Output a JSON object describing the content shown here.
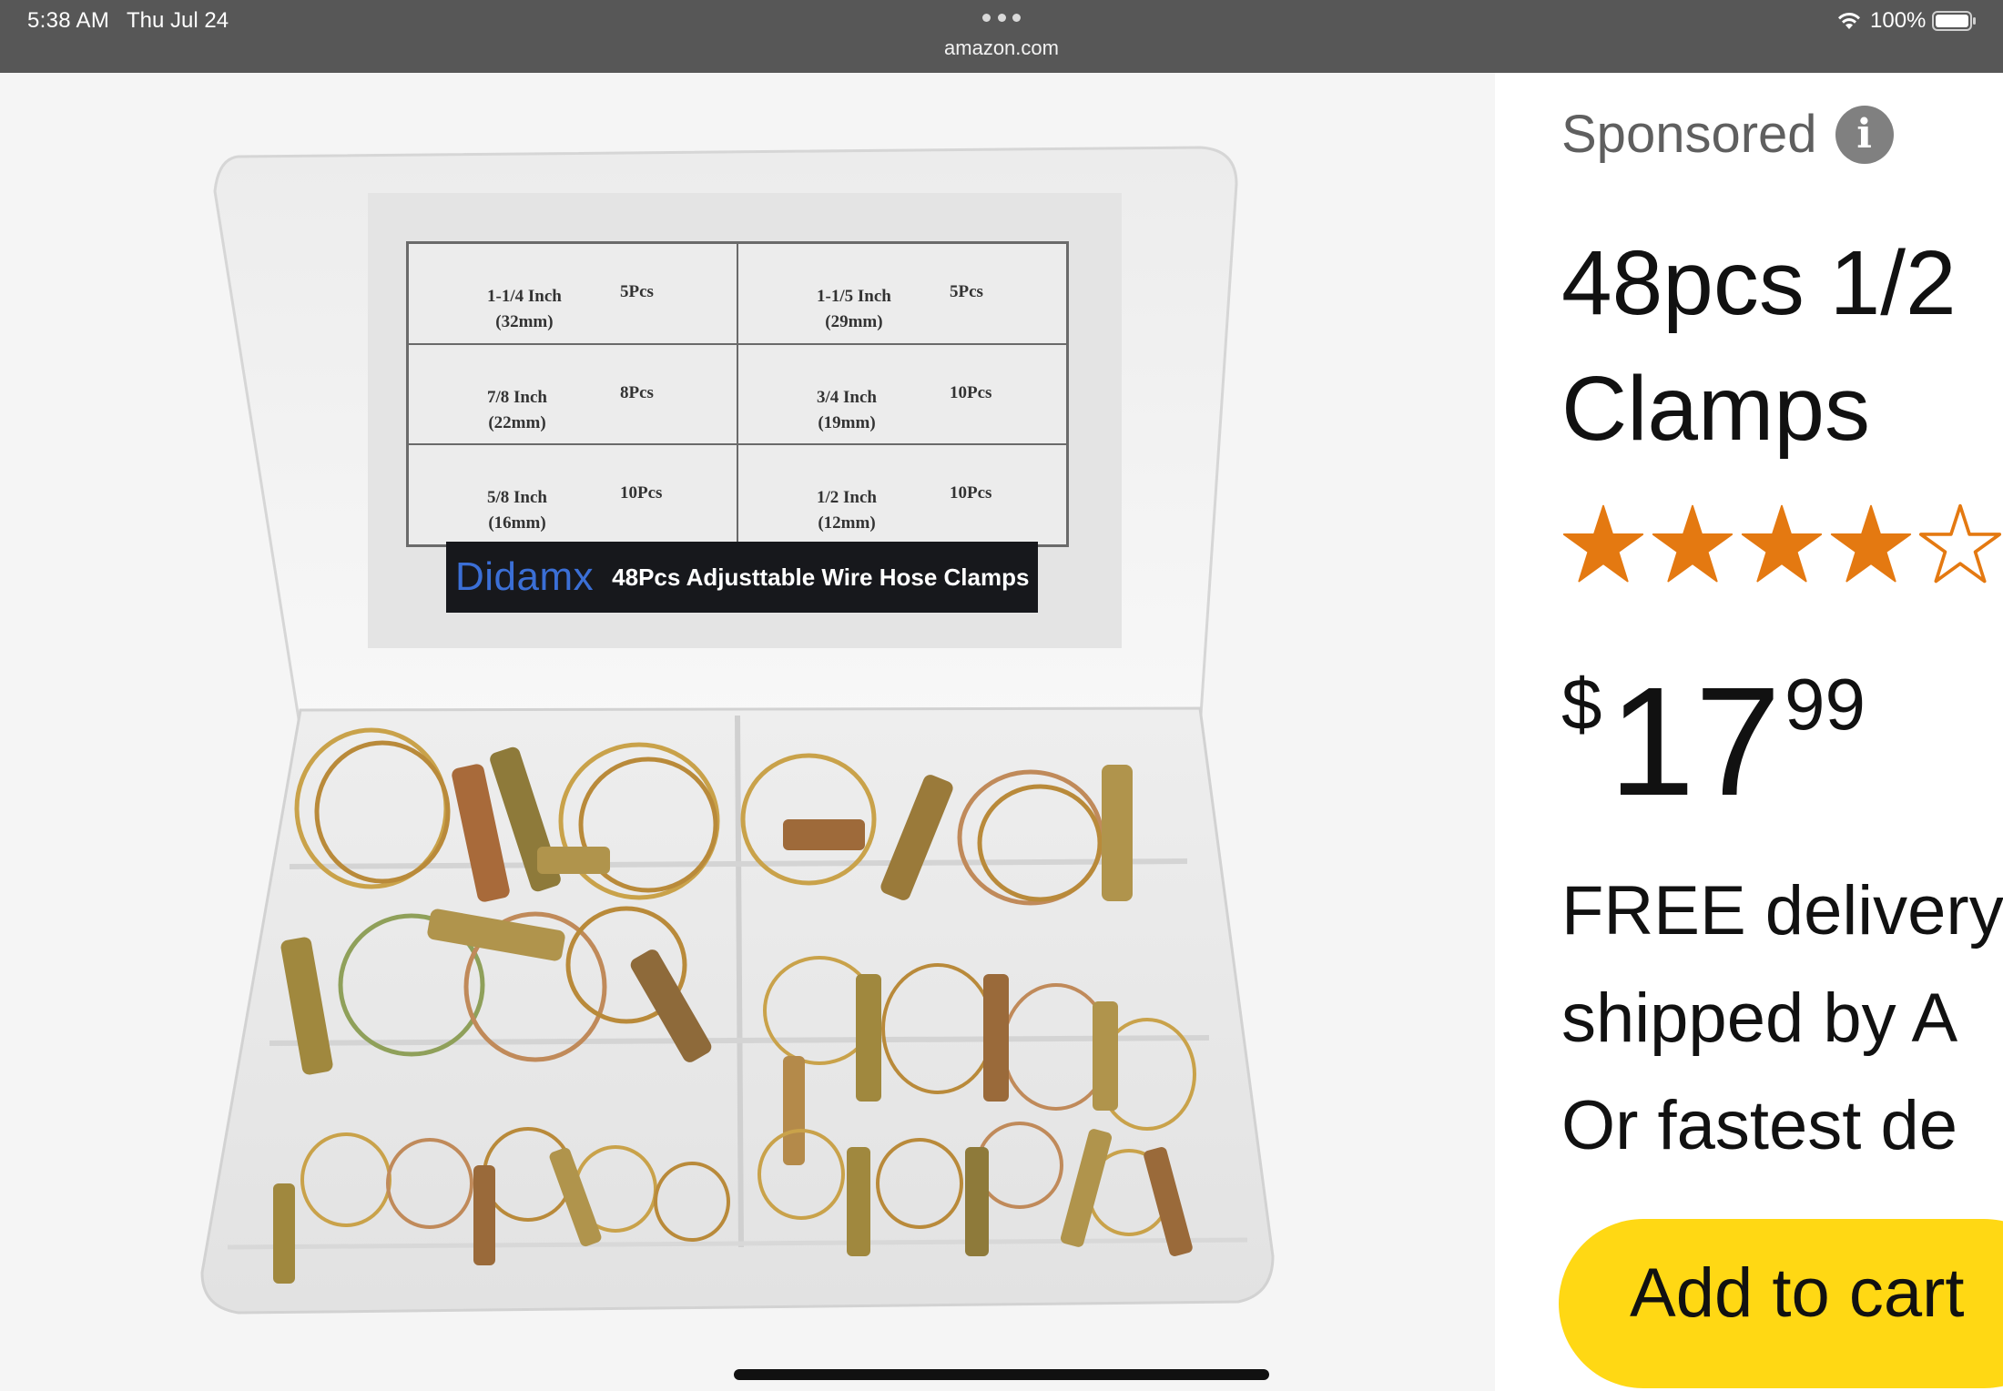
{
  "status_bar": {
    "time": "5:38 AM",
    "date": "Thu Jul 24",
    "url": "amazon.com",
    "battery": "100%"
  },
  "product_image": {
    "label_rows": [
      {
        "left_size": "1-1/4 Inch",
        "left_mm": "(32mm)",
        "left_qty": "5Pcs",
        "right_size": "1-1/5 Inch",
        "right_mm": "(29mm)",
        "right_qty": "5Pcs"
      },
      {
        "left_size": "7/8 Inch",
        "left_mm": "(22mm)",
        "left_qty": "8Pcs",
        "right_size": "3/4 Inch",
        "right_mm": "(19mm)",
        "right_qty": "10Pcs"
      },
      {
        "left_size": "5/8 Inch",
        "left_mm": "(16mm)",
        "left_qty": "10Pcs",
        "right_size": "1/2 Inch",
        "right_mm": "(12mm)",
        "right_qty": "10Pcs"
      }
    ],
    "brand": "Didamx",
    "brand_tagline": "48Pcs Adjusttable Wire Hose Clamps"
  },
  "product_info": {
    "sponsored_label": "Sponsored",
    "info_icon_glyph": "i",
    "title_line1": "48pcs 1/2",
    "title_line2": "Clamps",
    "rating": 4,
    "rating_max": 5,
    "star_color": "#e47911",
    "price_currency": "$",
    "price_whole": "17",
    "price_cents": "99",
    "delivery_line1": "FREE delivery",
    "delivery_line2": "shipped by A",
    "delivery_line3": "Or fastest de",
    "add_to_cart_label": "Add to cart",
    "button_color": "#ffd814"
  }
}
